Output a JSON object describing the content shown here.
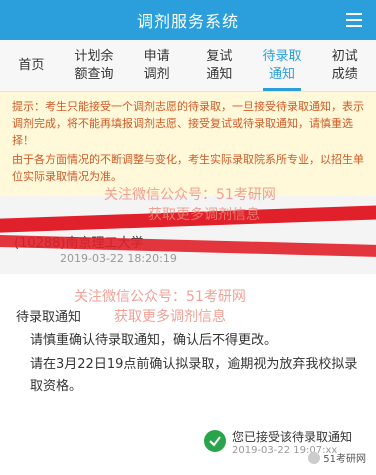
{
  "app": {
    "title": "调剂服务系统"
  },
  "tabs": [
    {
      "label": "首页",
      "active": false
    },
    {
      "label": "计划余\n额查询",
      "active": false
    },
    {
      "label": "申请\n调剂",
      "active": false
    },
    {
      "label": "复试\n通知",
      "active": false
    },
    {
      "label": "待录取\n通知",
      "active": true
    },
    {
      "label": "初试\n成绩",
      "active": false
    }
  ],
  "notice": {
    "p1": "提示：考生只能接受一个调剂志愿的待录取，一旦接受待录取通知，表示调剂完成，将不能再填报调剂志愿、接受复试或待录取通知，请慎重选择！",
    "p2": "由于各方面情况的不断调整与变化，考生实际录取院系所专业，以招生单位实际录取情况为准。"
  },
  "watermarks": {
    "w1": "关注微信公众号：51考研网",
    "w2": "获取更多调剂信息"
  },
  "record": {
    "school": "(10288)南京理工大学",
    "date": "2019-03-22 18:20:19"
  },
  "notification": {
    "header": "待录取通知",
    "line1": "请慎重确认待录取通知，确认后不得更改。",
    "line2": "请在3月22日19点前确认拟录取，逾期视为放弃我校拟录取资格。"
  },
  "status": {
    "text": "您已接受该待录取通知",
    "date": "2019-03-22 19:07:xx",
    "accent": "#2aa44a"
  },
  "brand": {
    "logo_text": "51考研网"
  },
  "colors": {
    "primary": "#2a9fdc",
    "notice_text": "#d05a28",
    "notice_bg": "#fff9d9",
    "strike": "#e0202a"
  }
}
